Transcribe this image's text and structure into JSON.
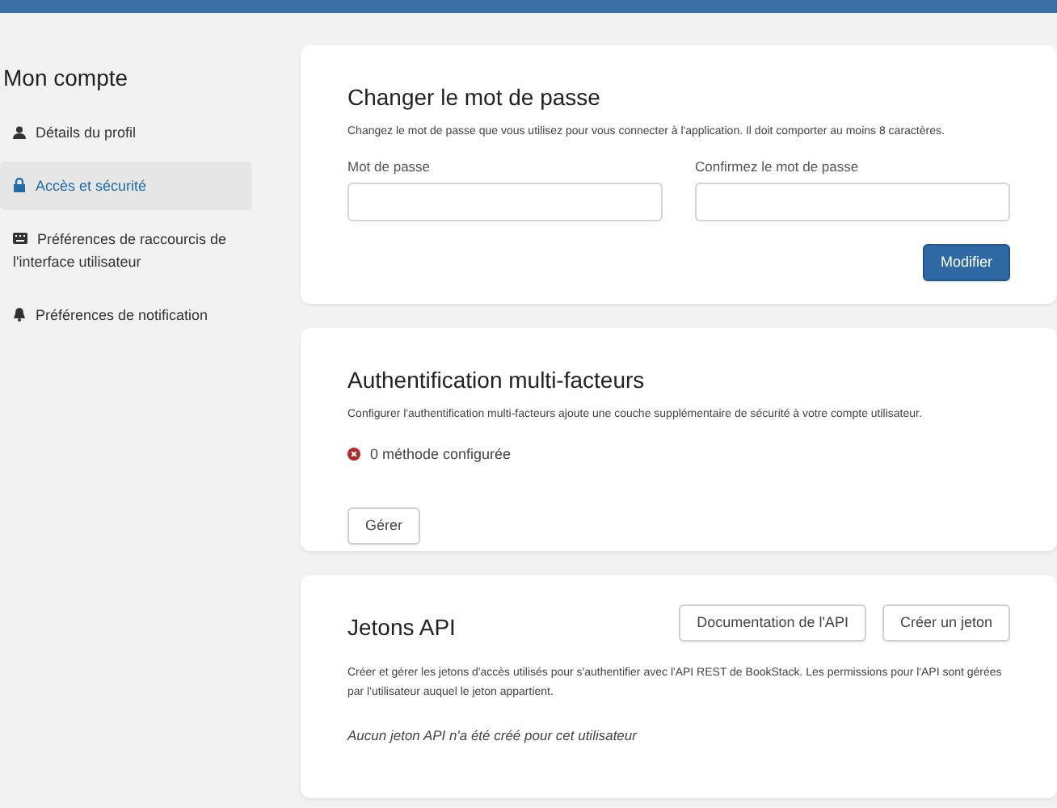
{
  "sidebar": {
    "title": "Mon compte",
    "items": [
      {
        "label": "Détails du profil",
        "selected": false
      },
      {
        "label": "Accès et sécurité",
        "selected": true
      },
      {
        "label": "Préférences de raccourcis de l'interface utilisateur",
        "selected": false
      },
      {
        "label": "Préférences de notification",
        "selected": false
      }
    ]
  },
  "password_card": {
    "title": "Changer le mot de passe",
    "description": "Changez le mot de passe que vous utilisez pour vous connecter à l'application. Il doit comporter au moins 8 caractères.",
    "fields": [
      {
        "label": "Mot de passe"
      },
      {
        "label": "Confirmez le mot de passe"
      }
    ],
    "button": "Modifier"
  },
  "mfa_card": {
    "title": "Authentification multi-facteurs",
    "description": "Configurer l'authentification multi-facteurs ajoute une couche supplémentaire de sécurité à votre compte utilisateur.",
    "status": "0 méthode configurée",
    "button": "Gérer"
  },
  "api_card": {
    "title": "Jetons API",
    "buttons": [
      "Documentation de l'API",
      "Créer un jeton"
    ],
    "description": "Créer et gérer les jetons d'accès utilisés pour s'authentifier avec l'API REST de BookStack. Les permissions pour l'API sont gérées par l'utilisateur auquel le jeton appartient.",
    "empty": "Aucun jeton API n'a été créé pour cet utilisateur"
  }
}
